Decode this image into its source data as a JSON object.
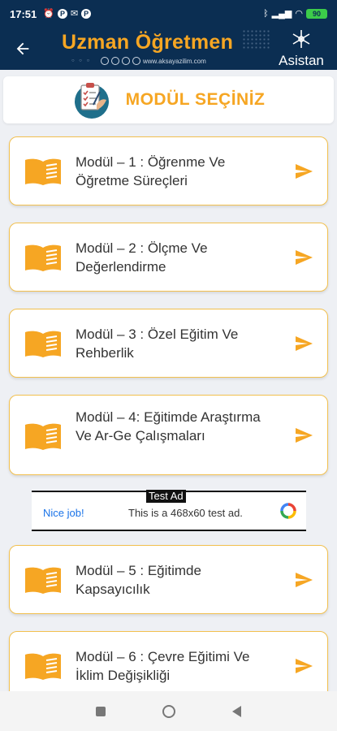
{
  "status_bar": {
    "time": "17:51",
    "battery": "90"
  },
  "header": {
    "title": "Uzman Öğretmen",
    "website": "www.aksayazilim.com",
    "assistant_label": "Asistan"
  },
  "page_title": "MODÜL SEÇİNİZ",
  "modules": [
    {
      "label": "Modül – 1 : Öğrenme Ve Öğretme Süreçleri"
    },
    {
      "label": "Modül – 2 : Ölçme Ve Değerlendirme"
    },
    {
      "label": "Modül – 3 : Özel Eğitim Ve Rehberlik"
    },
    {
      "label": "Modül – 4: Eğitimde Araştırma Ve Ar-Ge Çalışmaları"
    },
    {
      "label": "Modül – 5 : Eğitimde Kapsayıcılık"
    },
    {
      "label": "Modül – 6 : Çevre Eğitimi Ve İklim Değişikliği"
    }
  ],
  "ad": {
    "tag": "Test Ad",
    "nice_job": "Nice job!",
    "text": "This is a 468x60 test ad."
  },
  "colors": {
    "header_bg": "#0b2e52",
    "accent_orange": "#f6a623",
    "card_border": "#f2c04f",
    "page_bg": "#eef0f4"
  },
  "icons": {
    "back": "arrow-left-icon",
    "module": "open-book-icon",
    "go": "send-arrow-icon",
    "assistant": "snowflake-network-icon"
  }
}
